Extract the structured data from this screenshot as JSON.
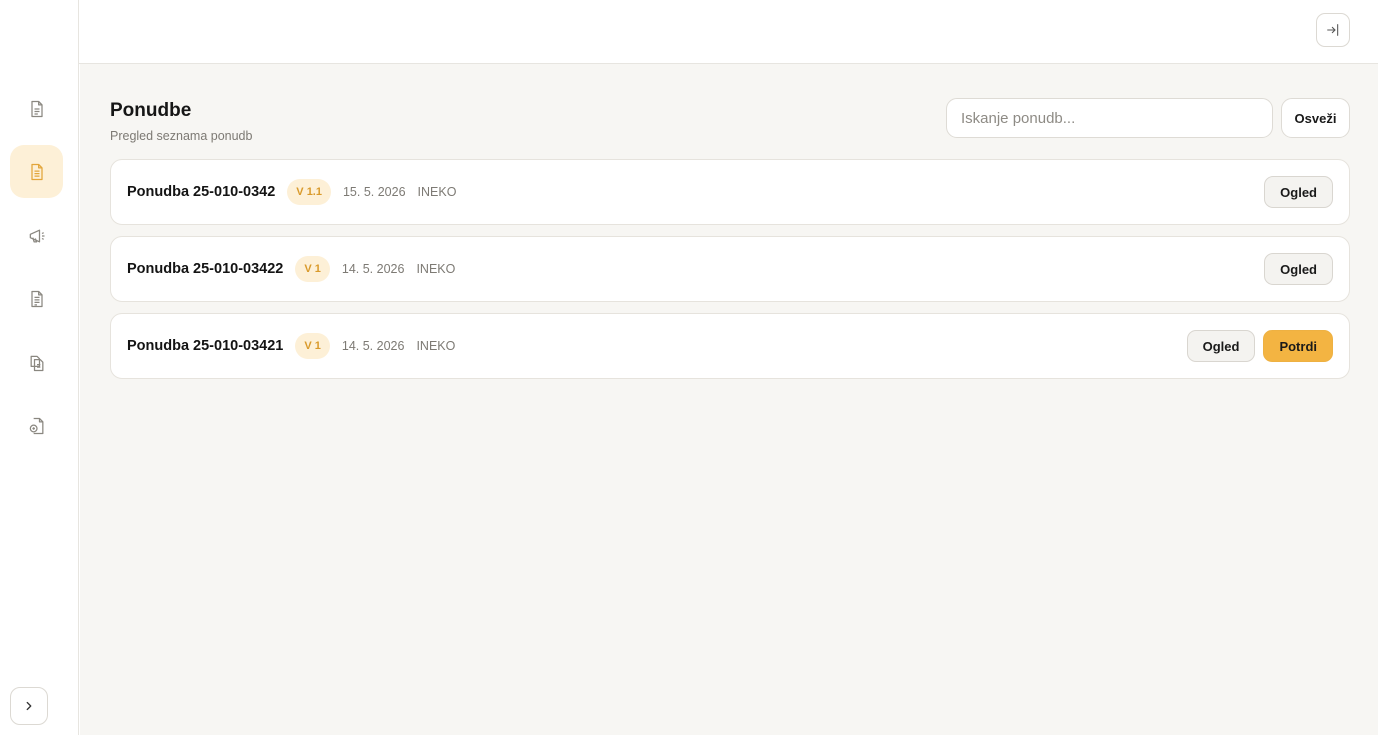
{
  "sidebar": {
    "items": [
      {
        "icon": "document-icon",
        "active": false
      },
      {
        "icon": "document-lines-icon",
        "active": true
      },
      {
        "icon": "megaphone-icon",
        "active": false
      },
      {
        "icon": "file-text-icon",
        "active": false
      },
      {
        "icon": "files-stack-icon",
        "active": false
      },
      {
        "icon": "file-sync-icon",
        "active": false
      }
    ],
    "expand_icon": "chevron-right-icon"
  },
  "topbar": {
    "logout_icon": "sign-out-icon"
  },
  "page": {
    "title": "Ponudbe",
    "subtitle": "Pregled seznama ponudb"
  },
  "search": {
    "placeholder": "Iskanje ponudb...",
    "value": ""
  },
  "toolbar": {
    "refresh_label": "Osveži"
  },
  "offers": [
    {
      "title": "Ponudba 25-010-0342",
      "version": "V 1.1",
      "date": "15. 5. 2026",
      "company": "INEKO",
      "actions": [
        "Ogled"
      ]
    },
    {
      "title": "Ponudba 25-010-03422",
      "version": "V 1",
      "date": "14. 5. 2026",
      "company": "INEKO",
      "actions": [
        "Ogled"
      ]
    },
    {
      "title": "Ponudba 25-010-03421",
      "version": "V 1",
      "date": "14. 5. 2026",
      "company": "INEKO",
      "actions": [
        "Ogled",
        "Potrdi"
      ]
    }
  ],
  "colors": {
    "accent": "#f3b442",
    "accent_soft": "#fdf0d7",
    "background": "#f7f6f3"
  }
}
